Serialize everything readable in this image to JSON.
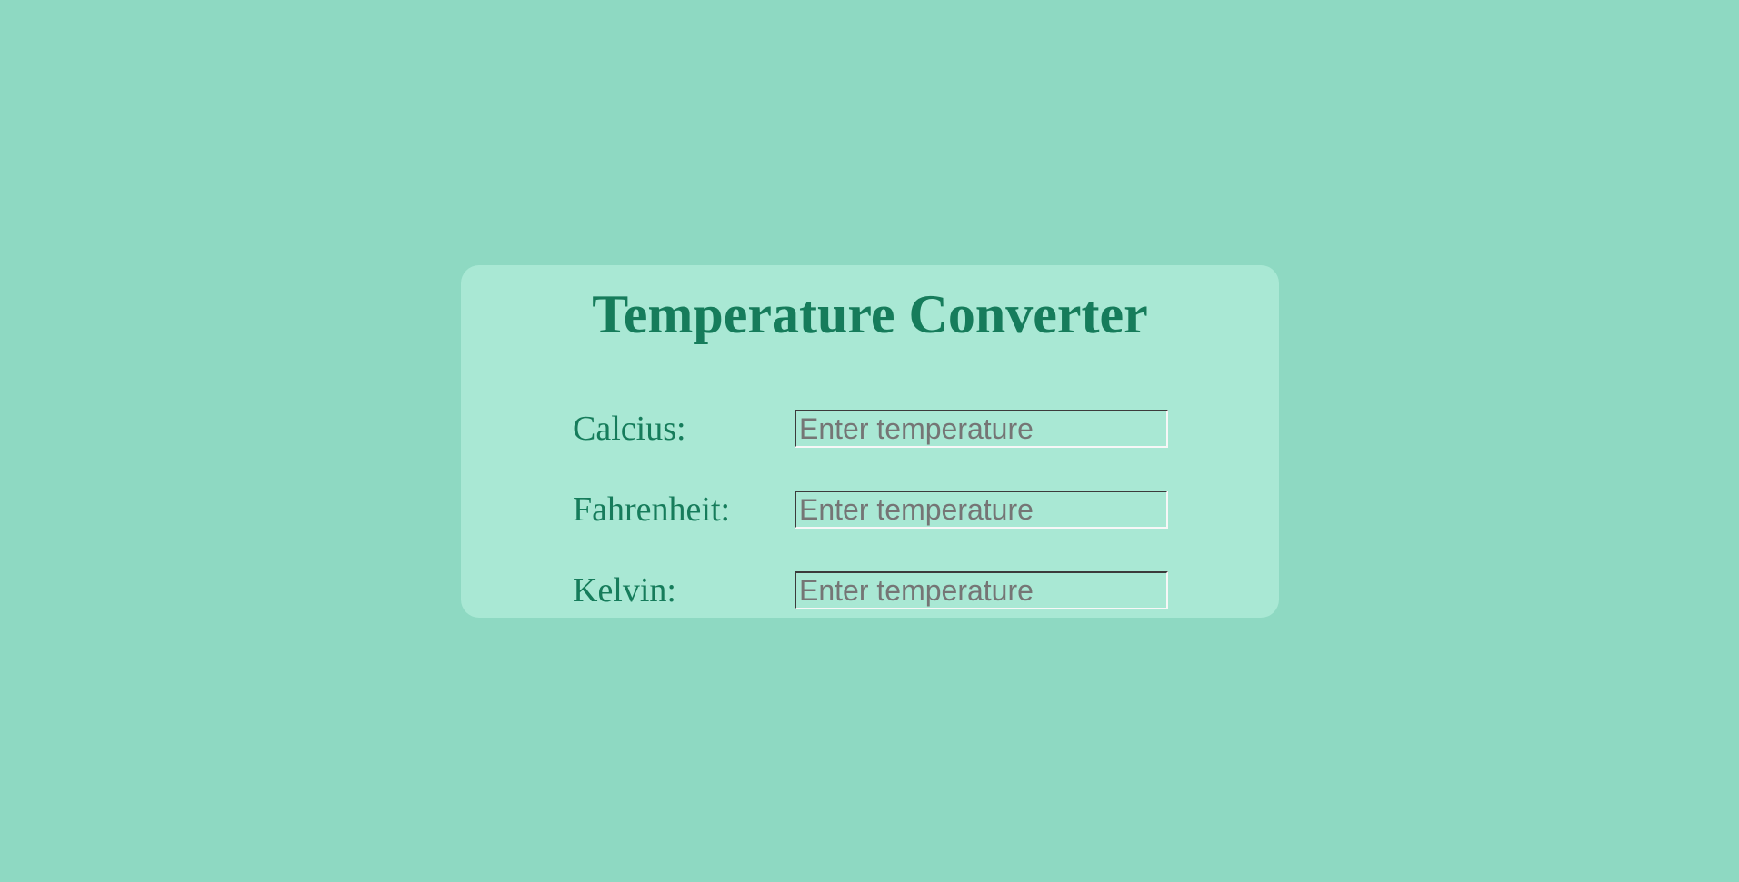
{
  "page": {
    "title": "Temperature Converter"
  },
  "colors": {
    "background": "#8ed9c2",
    "card": "#a9e8d4",
    "text": "#167c5b"
  },
  "converter": {
    "fields": [
      {
        "label": "Calcius:",
        "placeholder": "Enter temperature",
        "value": ""
      },
      {
        "label": "Fahrenheit:",
        "placeholder": "Enter temperature",
        "value": ""
      },
      {
        "label": "Kelvin:",
        "placeholder": "Enter temperature",
        "value": ""
      }
    ]
  }
}
